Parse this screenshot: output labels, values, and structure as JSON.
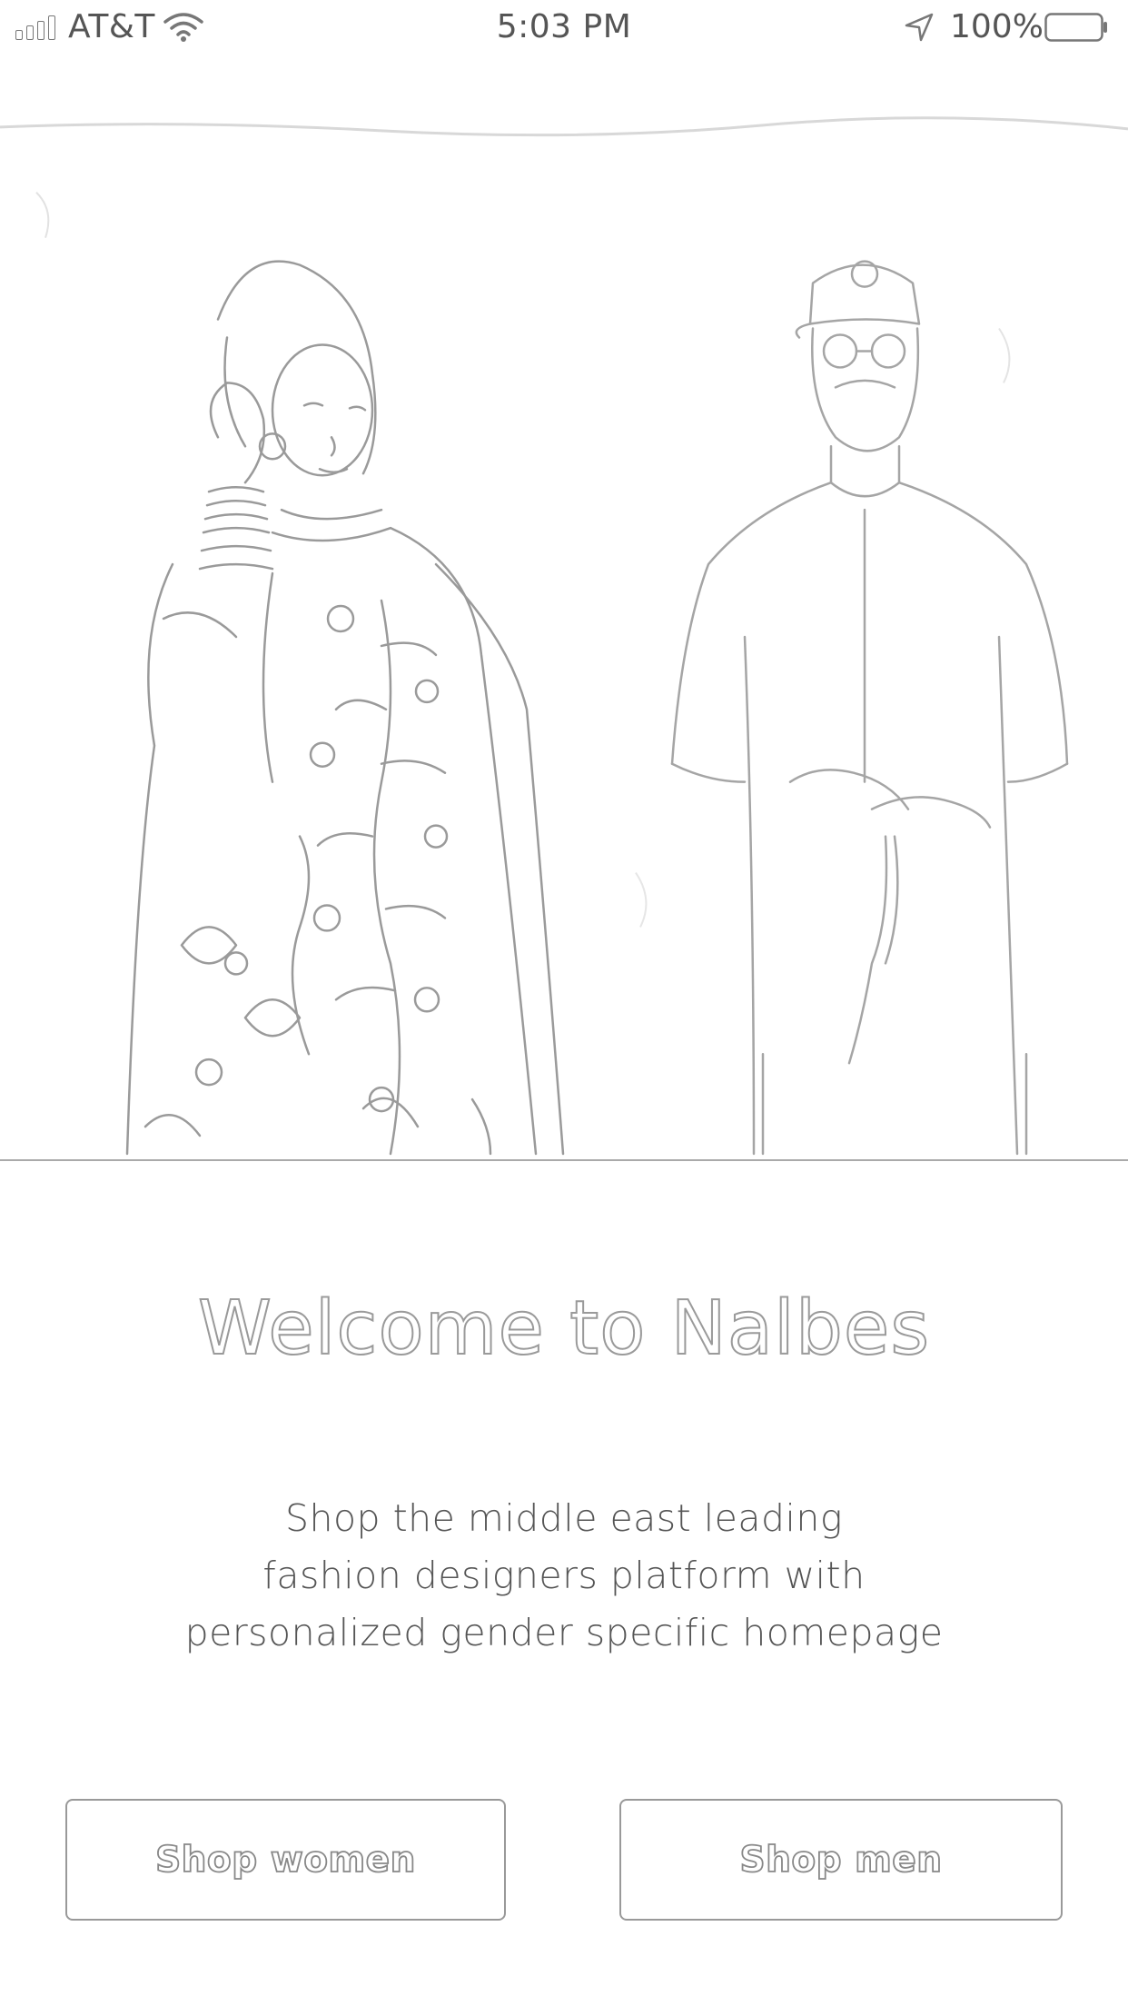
{
  "status_bar": {
    "carrier": "AT&T",
    "time": "5:03 PM",
    "battery_percent": "100%",
    "icons": [
      "signal-icon",
      "wifi-icon",
      "location-arrow-icon",
      "battery-icon"
    ]
  },
  "hero": {
    "image": "fashion-models-photo"
  },
  "welcome": {
    "title": "Welcome to Nalbes",
    "tagline_lines": [
      "Shop the middle east leading",
      "fashion designers platform with",
      "personalized gender specific homepage"
    ]
  },
  "actions": {
    "women_label": "Shop women",
    "men_label": "Shop men"
  },
  "colors": {
    "background": "#ffffff",
    "text": "#555555",
    "outline": "#999999"
  }
}
